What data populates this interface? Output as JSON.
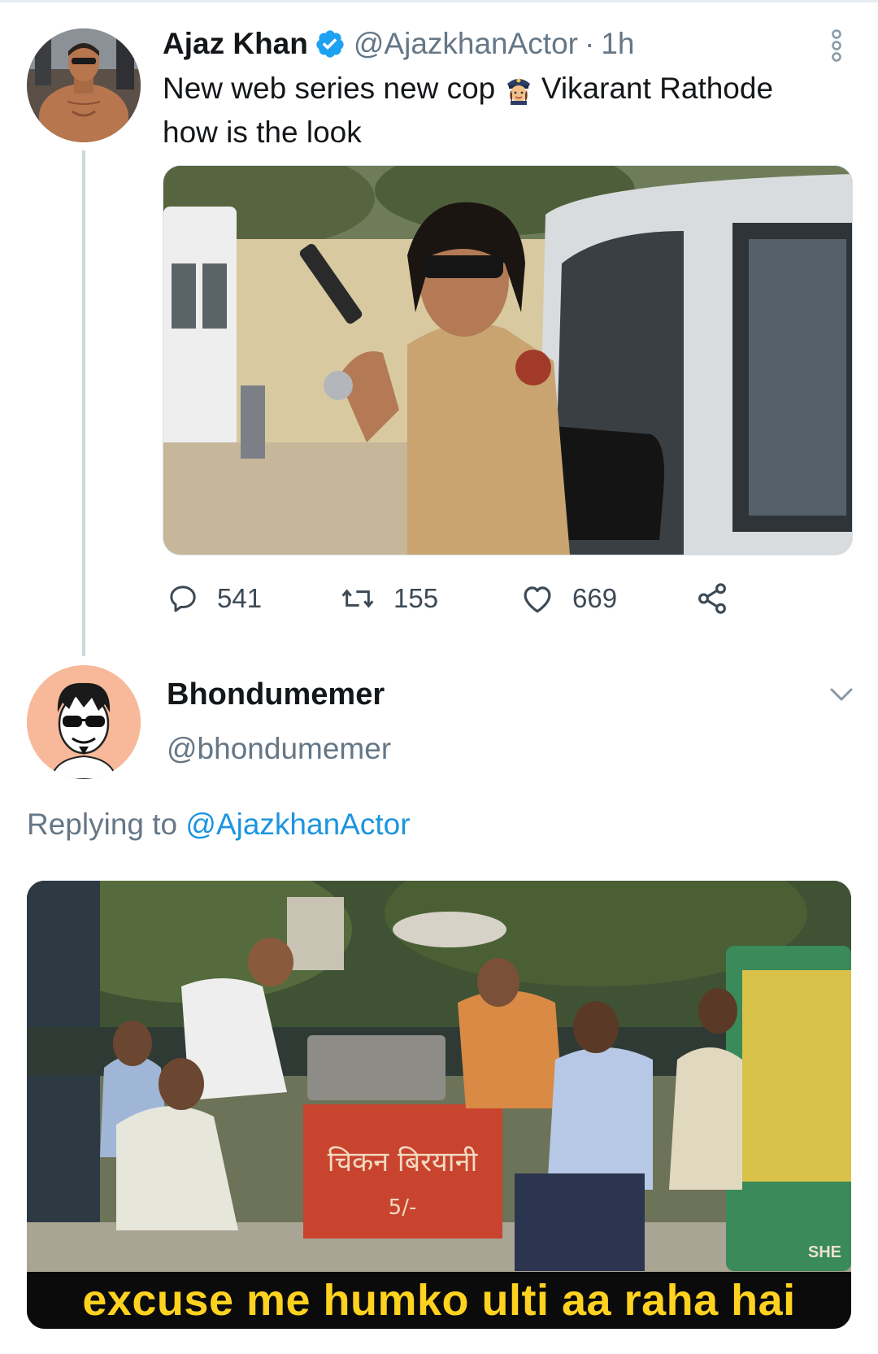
{
  "tweet": {
    "author_name": "Ajaz Khan",
    "handle": "@AjazkhanActor",
    "separator": "·",
    "time": "1h",
    "text_part1": "New web series new cop",
    "text_part2": "Vikarant Rathode how is the look",
    "emoji": "police-woman-emoji",
    "stats": {
      "replies": "541",
      "retweets": "155",
      "likes": "669"
    }
  },
  "reply": {
    "author_name": "Bhondumemer",
    "handle": "@bhondumemer",
    "replying_prefix": "Replying to ",
    "replying_to": "@AjazkhanActor",
    "meme_caption": "excuse me humko ulti aa raha hai",
    "sign_text": "चिकन बिरयानी",
    "watermark": "SHE"
  },
  "colors": {
    "link_blue": "#1b95e0",
    "muted_text": "#657786",
    "caption_yellow": "#ffd21f",
    "verified_blue": "#1da1f2"
  }
}
